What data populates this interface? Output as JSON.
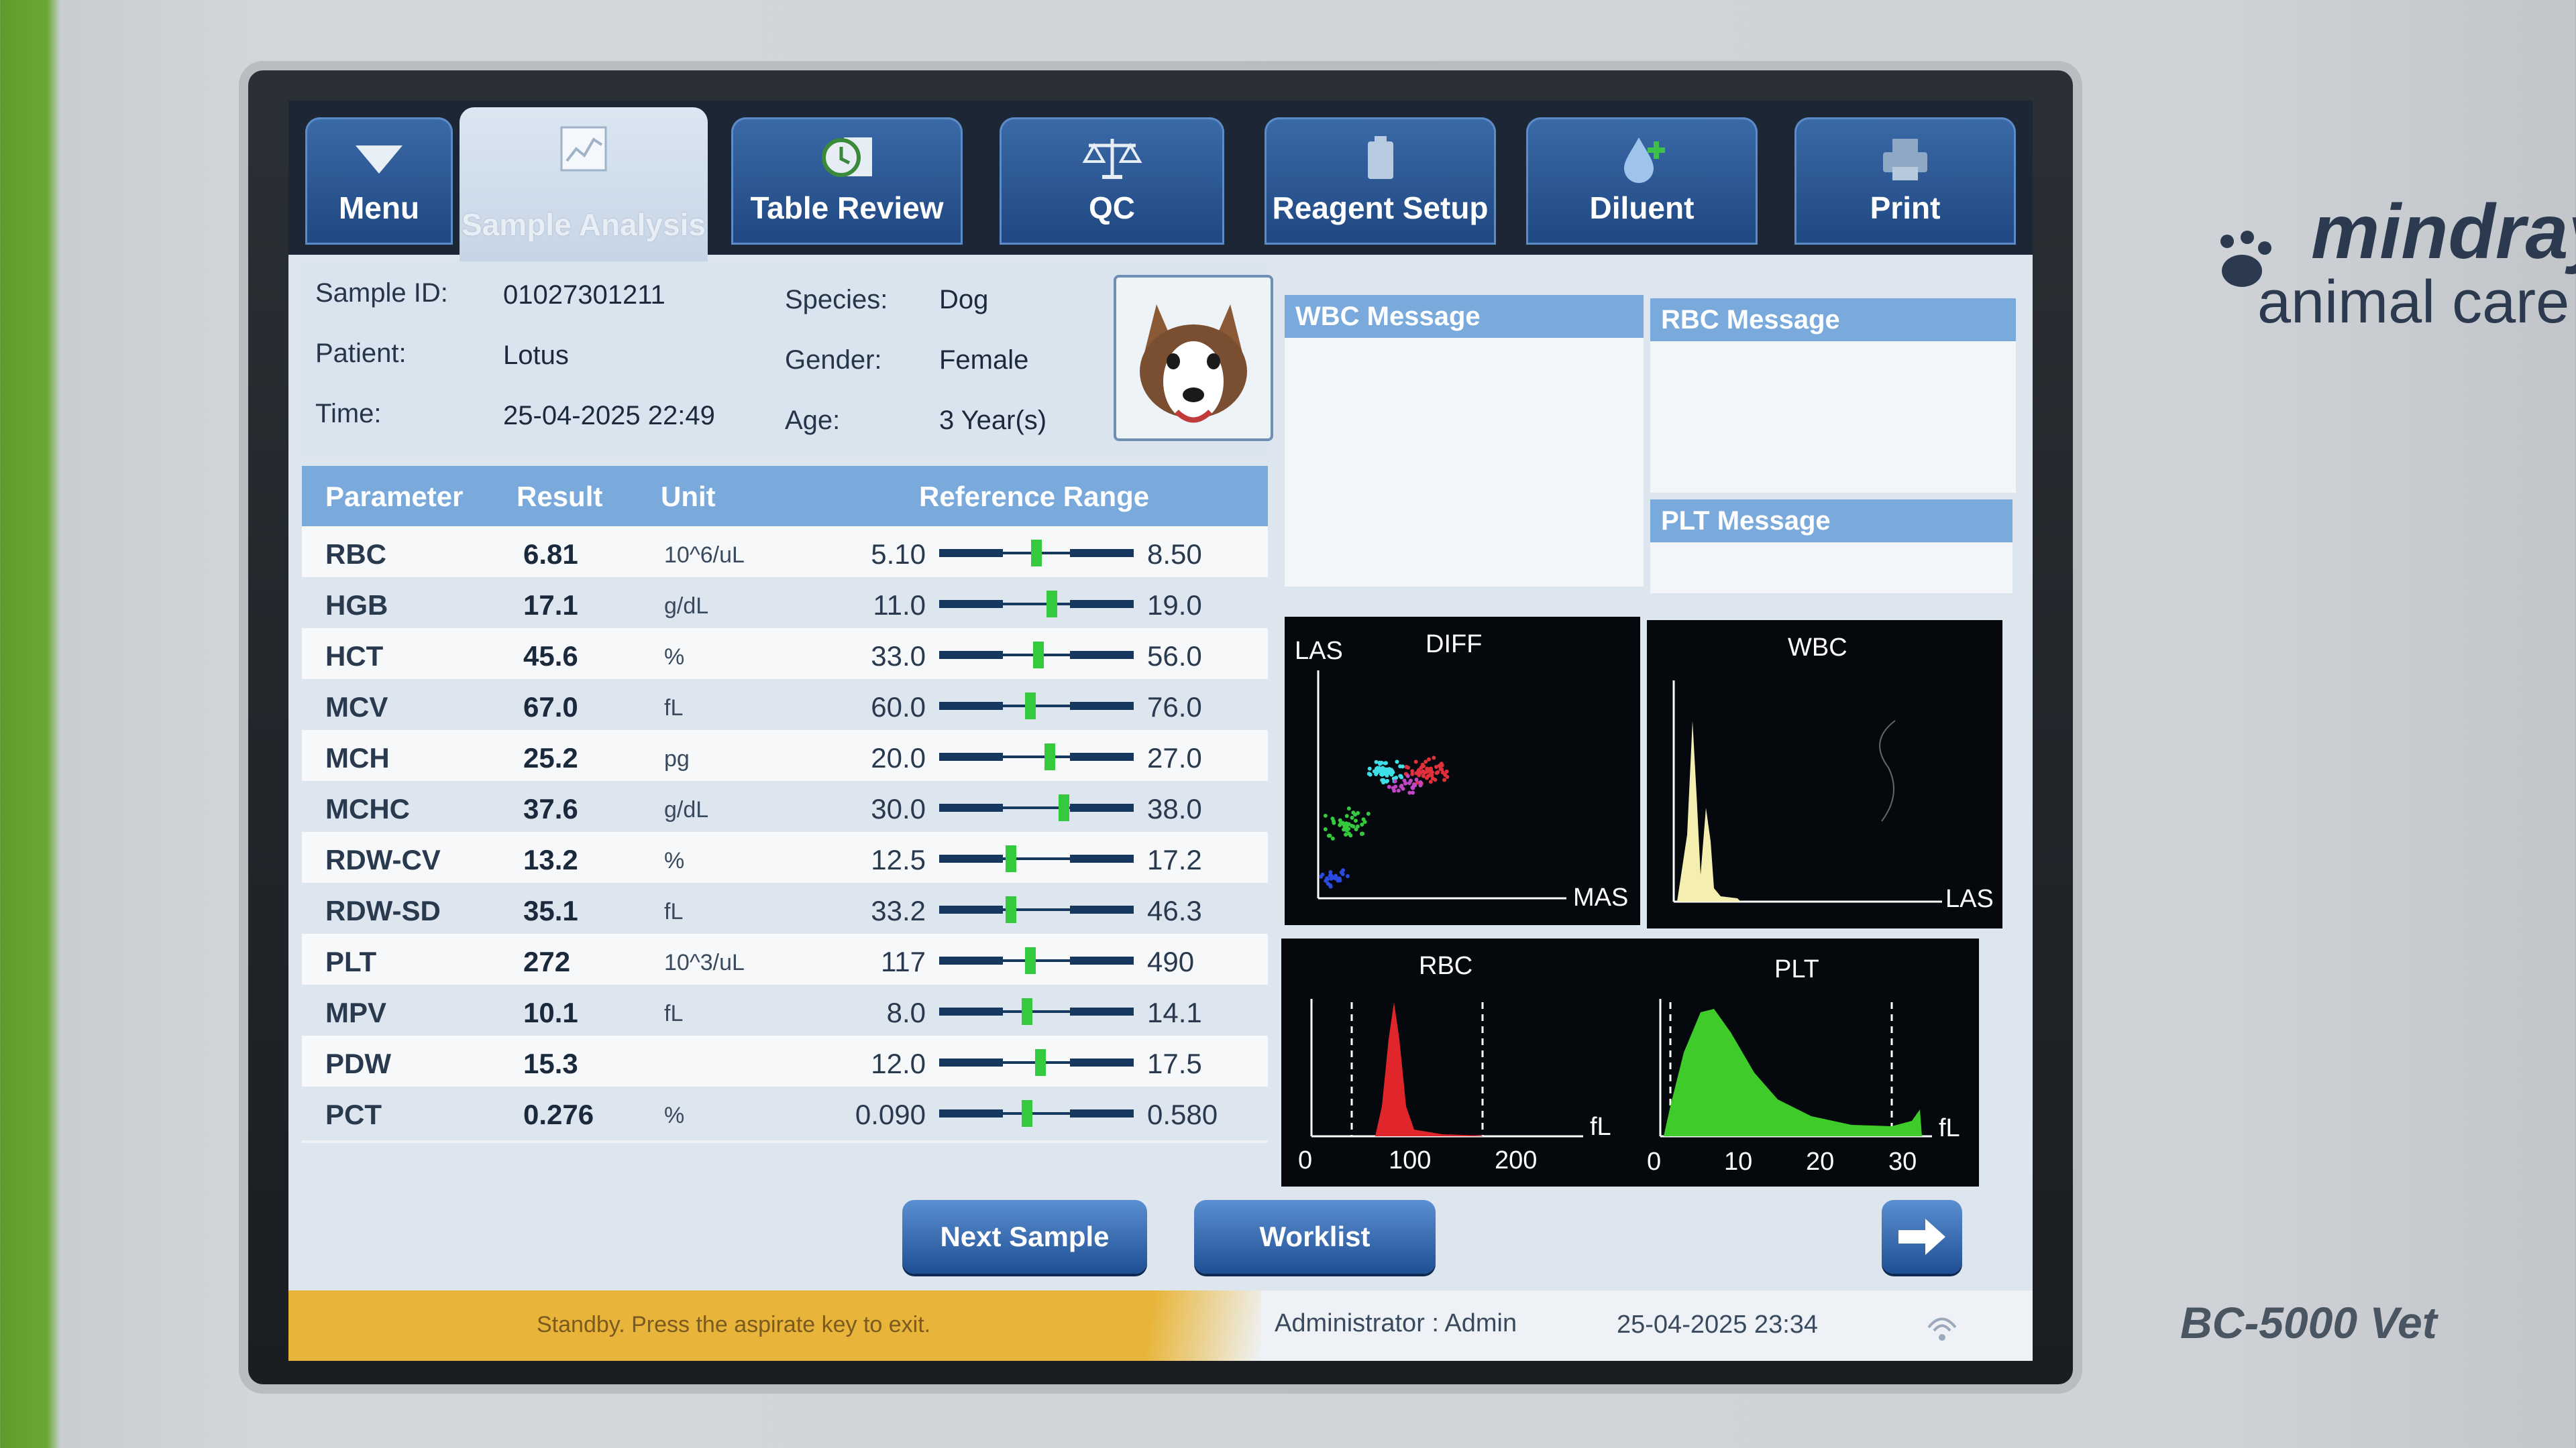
{
  "tabs": [
    {
      "label": "Menu",
      "icon": "triangle-down-icon"
    },
    {
      "label": "Sample Analysis",
      "icon": "chart-icon",
      "active": true
    },
    {
      "label": "Table Review",
      "icon": "clock-icon"
    },
    {
      "label": "QC",
      "icon": "scale-icon"
    },
    {
      "label": "Reagent Setup",
      "icon": "reagent-icon"
    },
    {
      "label": "Diluent",
      "icon": "drop-icon"
    },
    {
      "label": "Print",
      "icon": "printer-icon"
    }
  ],
  "sample": {
    "id_label": "Sample ID:",
    "id": "01027301211",
    "patient_label": "Patient:",
    "patient": "Lotus",
    "time_label": "Time:",
    "time": "25-04-2025 22:49",
    "species_label": "Species:",
    "species": "Dog",
    "gender_label": "Gender:",
    "gender": "Female",
    "age_label": "Age:",
    "age": "3 Year(s)"
  },
  "table": {
    "headers": [
      "Parameter",
      "Result",
      "Unit",
      "Reference Range"
    ],
    "rows": [
      {
        "param": "RBC",
        "result": "6.81",
        "unit": "10^6/uL",
        "low": "5.10",
        "high": "8.50",
        "pos": 0.5
      },
      {
        "param": "HGB",
        "result": "17.1",
        "unit": "g/dL",
        "low": "11.0",
        "high": "19.0",
        "pos": 0.58
      },
      {
        "param": "HCT",
        "result": "45.6",
        "unit": "%",
        "low": "33.0",
        "high": "56.0",
        "pos": 0.51
      },
      {
        "param": "MCV",
        "result": "67.0",
        "unit": "fL",
        "low": "60.0",
        "high": "76.0",
        "pos": 0.47
      },
      {
        "param": "MCH",
        "result": "25.2",
        "unit": "pg",
        "low": "20.0",
        "high": "27.0",
        "pos": 0.57
      },
      {
        "param": "MCHC",
        "result": "37.6",
        "unit": "g/dL",
        "low": "30.0",
        "high": "38.0",
        "pos": 0.64
      },
      {
        "param": "RDW-CV",
        "result": "13.2",
        "unit": "%",
        "low": "12.5",
        "high": "17.2",
        "pos": 0.37
      },
      {
        "param": "RDW-SD",
        "result": "35.1",
        "unit": "fL",
        "low": "33.2",
        "high": "46.3",
        "pos": 0.37
      },
      {
        "param": "PLT",
        "result": "272",
        "unit": "10^3/uL",
        "low": "117",
        "high": "490",
        "pos": 0.47
      },
      {
        "param": "MPV",
        "result": "10.1",
        "unit": "fL",
        "low": "8.0",
        "high": "14.1",
        "pos": 0.45
      },
      {
        "param": "PDW",
        "result": "15.3",
        "unit": "",
        "low": "12.0",
        "high": "17.5",
        "pos": 0.52
      },
      {
        "param": "PCT",
        "result": "0.276",
        "unit": "%",
        "low": "0.090",
        "high": "0.580",
        "pos": 0.45
      }
    ]
  },
  "messages": {
    "wbc": "WBC Message",
    "rbc": "RBC Message",
    "plt": "PLT Message"
  },
  "plots": {
    "diff": {
      "title": "DIFF",
      "y": "LAS",
      "x": "MAS"
    },
    "wbc": {
      "title": "WBC",
      "x": "LAS"
    },
    "rbc": {
      "title": "RBC",
      "unit": "fL",
      "ticks": [
        "0",
        "100",
        "200"
      ]
    },
    "plt": {
      "title": "PLT",
      "unit": "fL",
      "ticks": [
        "0",
        "10",
        "20",
        "30"
      ]
    }
  },
  "buttons": {
    "next": "Next Sample",
    "worklist": "Worklist"
  },
  "status": {
    "message": "Standby. Press the aspirate key to exit.",
    "user": "Administrator : Admin",
    "datetime": "25-04-2025 23:34"
  },
  "device": {
    "brand_top": "mindray",
    "brand_bottom": "animal care",
    "model": "BC-5000 Vet"
  },
  "colors": {
    "marker": "#35c93e",
    "header": "#7aa9dc",
    "tab": "#2b5a98",
    "status": "#e8b53a"
  }
}
